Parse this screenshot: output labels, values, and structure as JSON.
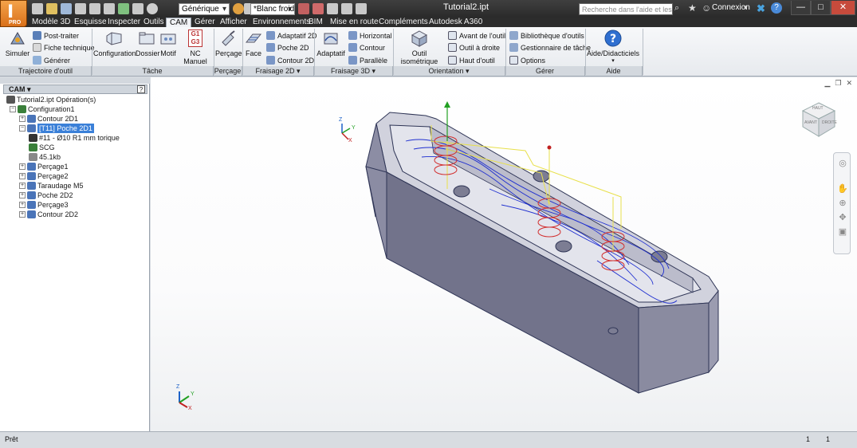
{
  "window": {
    "doc_title": "Tutorial2.ipt",
    "search_placeholder": "Recherche dans l'aide et les com",
    "signin_label": "Connexion",
    "help_symbol": "?",
    "app_pro_label": "PRO",
    "app_glyph": "I",
    "min_glyph": "—",
    "max_glyph": "□",
    "close_glyph": "✕"
  },
  "quick_access": {
    "appearance_dropdown": "Générique",
    "material_dropdown": "*Blanc froid"
  },
  "menu_tabs": [
    {
      "label": "Modèle 3D"
    },
    {
      "label": "Esquisse"
    },
    {
      "label": "Inspecter"
    },
    {
      "label": "Outils"
    },
    {
      "label": "CAM"
    },
    {
      "label": "Gérer"
    },
    {
      "label": "Afficher"
    },
    {
      "label": "Environnements"
    },
    {
      "label": "BIM"
    },
    {
      "label": "Mise en route"
    },
    {
      "label": "Compléments"
    },
    {
      "label": "Autodesk A360"
    }
  ],
  "active_tab_index": 4,
  "ribbon": {
    "trajectoire": {
      "title": "Trajectoire d'outil",
      "simuler": "Simuler",
      "post_traiter": "Post-traiter",
      "fiche_technique": "Fiche technique",
      "generer": "Générer"
    },
    "tache": {
      "title": "Tâche",
      "configuration": "Configuration",
      "dossier": "Dossier",
      "motif": "Motif",
      "nc_manuel": "NC Manuel",
      "nc_icon_top": "G1",
      "nc_icon_bottom": "G3"
    },
    "percage": {
      "title": "Perçage",
      "percage": "Perçage"
    },
    "fraisage2d": {
      "title": "Fraisage 2D",
      "face": "Face",
      "adaptatif_2d": "Adaptatif 2D",
      "poche_2d": "Poche 2D",
      "contour_2d": "Contour 2D"
    },
    "fraisage3d": {
      "title": "Fraisage 3D",
      "adaptatif": "Adaptatif",
      "horizontal": "Horizontal",
      "contour": "Contour",
      "parallele": "Parallèle"
    },
    "orientation": {
      "title": "Orientation",
      "outil_isometrique": "Outil isométrique",
      "avant_outil": "Avant de l'outil",
      "outil_droite": "Outil à droite",
      "haut_outil": "Haut d'outil"
    },
    "gerer": {
      "title": "Gérer",
      "bibliotheque": "Bibliothèque d'outils",
      "gestionnaire": "Gestionnaire de tâche",
      "options": "Options"
    },
    "aide": {
      "title": "Aide",
      "aide_didacticiels": "Aide/Didacticiels"
    }
  },
  "browser": {
    "header": "CAM",
    "tree": [
      {
        "label": "Tutorial2.ipt Opération(s)"
      },
      {
        "label": "Configuration1"
      },
      {
        "label": "Contour 2D1"
      },
      {
        "label": "[T11] Poche 2D1"
      },
      {
        "label": "#11 - Ø10 R1 mm torique"
      },
      {
        "label": "SCG"
      },
      {
        "label": "45.1kb"
      },
      {
        "label": "Perçage1"
      },
      {
        "label": "Perçage2"
      },
      {
        "label": "Taraudage M5"
      },
      {
        "label": "Poche 2D2"
      },
      {
        "label": "Perçage3"
      },
      {
        "label": "Contour 2D2"
      }
    ]
  },
  "viewport": {
    "viewcube_front": "AVANT",
    "viewcube_right": "DROITE",
    "viewcube_top": "HAUT",
    "axis_x": "X",
    "axis_y": "Y",
    "axis_z": "Z"
  },
  "status": {
    "text": "Prêt",
    "count1": "1",
    "count2": "1"
  },
  "colors": {
    "part": "#6e6f86",
    "toolpath_blue": "#1f2fd0",
    "toolpath_yellow": "#e8e04a",
    "drill_red": "#d23030",
    "selection": "#3b80d8"
  }
}
